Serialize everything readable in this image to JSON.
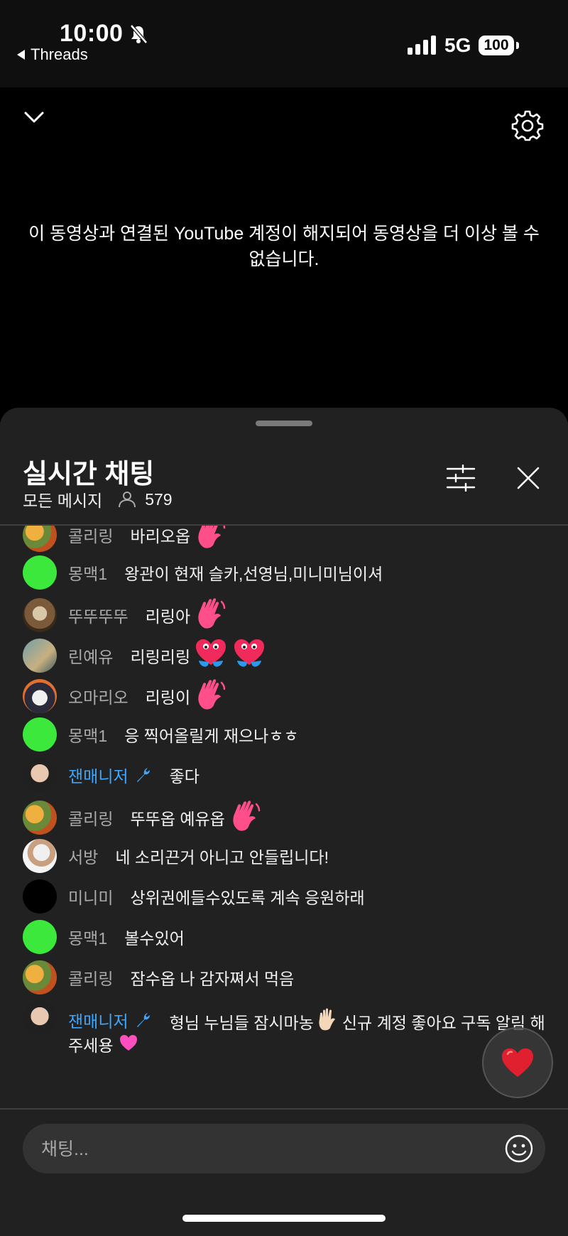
{
  "status_bar": {
    "time": "10:00",
    "back_app": "Threads",
    "network": "5G",
    "battery": "100"
  },
  "video": {
    "unavailable_message": "이 동영상과 연결된 YouTube 계정이 해지되어 동영상을 더 이상 볼 수 없습니다."
  },
  "chat": {
    "title": "실시간 채팅",
    "filter_label": "모든 메시지",
    "viewer_count": "579",
    "input_placeholder": "채팅...",
    "messages": [
      {
        "author": "콜리링",
        "text": "바리오옵",
        "emoji": "wave"
      },
      {
        "author": "몽맥1",
        "text": "왕관이 현재 슬카,선영님,미니미님이셔",
        "emoji": ""
      },
      {
        "author": "뚜뚜뚜뚜",
        "text": "리링아",
        "emoji": "wave"
      },
      {
        "author": "린예유",
        "text": "리링리링",
        "emoji": "hearts"
      },
      {
        "author": "오마리오",
        "text": "리링이",
        "emoji": "wave"
      },
      {
        "author": "몽맥1",
        "text": "응 찍어올릴게 재으나ㅎㅎ",
        "emoji": ""
      },
      {
        "author": "잰매니저",
        "text": "좋다",
        "emoji": "",
        "owner": true
      },
      {
        "author": "콜리링",
        "text": "뚜뚜옵 예유옵",
        "emoji": "wave"
      },
      {
        "author": "서방",
        "text": "네 소리끈거 아니고 안들립니다!",
        "emoji": ""
      },
      {
        "author": "미니미",
        "text": "상위권에들수있도록 계속 응원하래",
        "emoji": ""
      },
      {
        "author": "몽맥1",
        "text": "볼수있어",
        "emoji": ""
      },
      {
        "author": "콜리링",
        "text": "잠수옵 나 감자쪄서 먹음",
        "emoji": ""
      },
      {
        "author": "잰매니저",
        "text": "형님 누님들 잠시마농",
        "text_2": "신규 계정 좋아요 구독 알림 해",
        "text_3": "주세용",
        "emoji": "hand",
        "owner": true
      }
    ]
  },
  "colors": {
    "owner_name": "#3ea6ff",
    "author_name": "#aaaaaa",
    "sheet_bg": "#212121",
    "reaction_heart": "#e0202e",
    "wave_emoji": "#ff4f8b"
  },
  "icons": [
    "bell-slash-icon",
    "signal-icon",
    "chevron-down-icon",
    "gear-icon",
    "person-icon",
    "sliders-icon",
    "close-icon",
    "wrench-icon",
    "heart-icon",
    "smiley-icon"
  ]
}
